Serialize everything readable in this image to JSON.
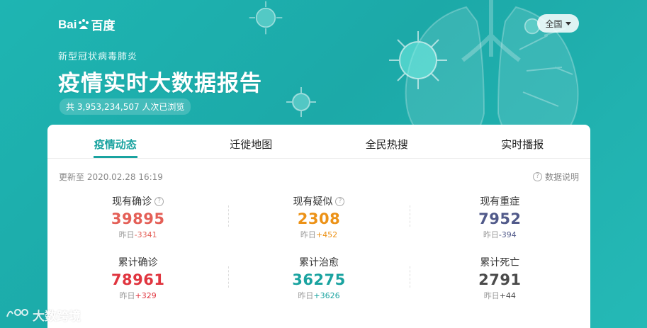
{
  "header": {
    "logo_text_left": "Bai",
    "logo_text_right": "百度",
    "subtitle": "新型冠状病毒肺炎",
    "title": "疫情实时大数据报告",
    "views": "共 3,953,234,507 人次已浏览",
    "region_label": "全国"
  },
  "tabs": [
    {
      "label": "疫情动态",
      "active": true
    },
    {
      "label": "迁徙地图",
      "active": false
    },
    {
      "label": "全民热搜",
      "active": false
    },
    {
      "label": "实时播报",
      "active": false
    }
  ],
  "meta": {
    "updated": "更新至 2020.02.28 16:19",
    "data_note": "数据说明"
  },
  "stats": [
    {
      "label": "现有确诊",
      "value": "39895",
      "delta_prefix": "昨日",
      "delta": "-3341",
      "color": "#e45f57",
      "delta_color": "#e45f57",
      "help": true
    },
    {
      "label": "现有疑似",
      "value": "2308",
      "delta_prefix": "昨日",
      "delta": "+452",
      "color": "#ec9217",
      "delta_color": "#ec9217",
      "help": true
    },
    {
      "label": "现有重症",
      "value": "7952",
      "delta_prefix": "昨日",
      "delta": "-394",
      "color": "#515a8a",
      "delta_color": "#515a8a",
      "help": false
    },
    {
      "label": "累计确诊",
      "value": "78961",
      "delta_prefix": "昨日",
      "delta": "+329",
      "color": "#e0353f",
      "delta_color": "#e0353f",
      "help": false
    },
    {
      "label": "累计治愈",
      "value": "36275",
      "delta_prefix": "昨日",
      "delta": "+3626",
      "color": "#1aa3a0",
      "delta_color": "#1aa3a0",
      "help": false
    },
    {
      "label": "累计死亡",
      "value": "2791",
      "delta_prefix": "昨日",
      "delta": "+44",
      "color": "#4b4b4b",
      "delta_color": "#4b4b4b",
      "help": false
    }
  ],
  "watermark": {
    "text": "大数跨境"
  },
  "colors": {
    "accent": "#1aa3a0",
    "background": "#1fb0ae"
  }
}
